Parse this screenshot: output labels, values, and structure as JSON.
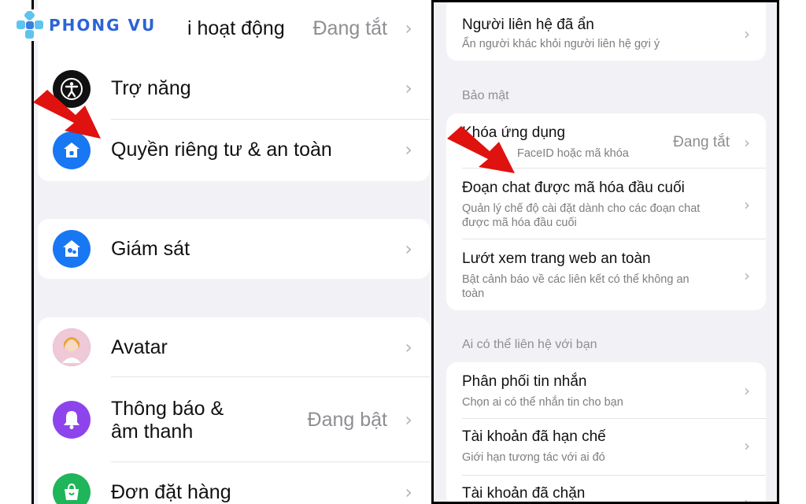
{
  "brand": {
    "logo_text": "PHONG VU",
    "logo_color": "#2a64d6"
  },
  "left": {
    "top_row": {
      "label": "i hoạt động",
      "value": "Đang tắt"
    },
    "group1": [
      {
        "label": "Trợ năng",
        "icon": "accessibility-icon",
        "icon_bg": "#111111"
      },
      {
        "label": "Quyền riêng tư & an toàn",
        "icon": "privacy-shield-icon",
        "icon_bg": "#1877f2"
      }
    ],
    "group2": [
      {
        "label": "Giám sát",
        "icon": "supervision-icon",
        "icon_bg": "#1877f2"
      }
    ],
    "group3": [
      {
        "label": "Avatar",
        "icon": "avatar-icon",
        "icon_bg": "#8e44ec"
      },
      {
        "label_line1": "Thông báo &",
        "label_line2": "âm thanh",
        "value": "Đang bật",
        "icon": "bell-icon",
        "icon_bg": "#8e44ec"
      },
      {
        "label": "Đơn đặt hàng",
        "icon": "shopping-bag-icon",
        "icon_bg": "#1fb55a"
      }
    ]
  },
  "right": {
    "hidden_contacts": {
      "title": "Người liên hệ đã ẩn",
      "subtitle": "Ẩn người khác khỏi người liên hệ gợi ý"
    },
    "security_header": "Bảo mật",
    "security": [
      {
        "title": "Khóa ứng dụng",
        "subtitle": "FaceID hoặc mã khóa",
        "value": "Đang tắt"
      },
      {
        "title": "Đoạn chat được mã hóa đầu cuối",
        "subtitle": "Quản lý chế độ cài đặt dành cho các đoạn chat được mã hóa đầu cuối"
      },
      {
        "title": "Lướt xem trang web an toàn",
        "subtitle": "Bật cảnh báo về các liên kết có thể không an toàn"
      }
    ],
    "contact_header": "Ai có thể liên hệ với bạn",
    "contact": [
      {
        "title": "Phân phối tin nhắn",
        "subtitle": "Chọn ai có thể nhắn tin cho bạn"
      },
      {
        "title": "Tài khoản đã hạn chế",
        "subtitle": "Giới hạn tương tác với ai đó"
      },
      {
        "title": "Tài khoản đã chặn"
      }
    ]
  },
  "annotation_color": "#e0120f"
}
